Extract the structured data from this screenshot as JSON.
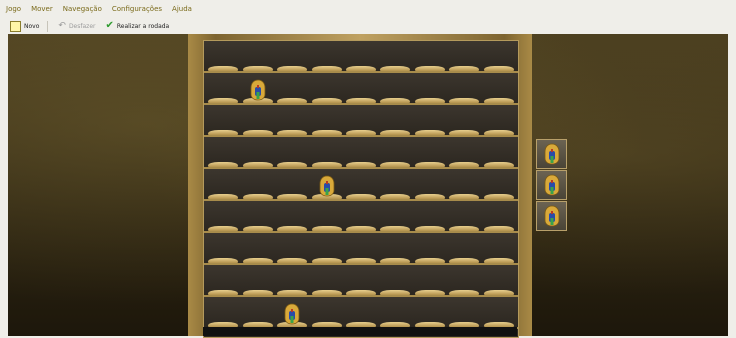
{
  "menu": {
    "items": [
      {
        "label": "Jogo"
      },
      {
        "label": "Mover"
      },
      {
        "label": "Navegação"
      },
      {
        "label": "Configurações"
      },
      {
        "label": "Ajuda"
      }
    ]
  },
  "toolbar": {
    "new_label": "Novo",
    "undo_label": "Desfazer",
    "play_label": "Realizar a rodada"
  },
  "board": {
    "columns": 9,
    "rows": 9,
    "pieces": [
      {
        "row": 1,
        "col": 1
      },
      {
        "row": 4,
        "col": 3
      },
      {
        "row": 8,
        "col": 2
      }
    ]
  },
  "side_tray": {
    "pieces": 3
  },
  "colors": {
    "piece_gold": "#d9a93a",
    "piece_blue": "#2a4ca8",
    "piece_green": "#3aa34a",
    "piece_red": "#b93a24"
  }
}
